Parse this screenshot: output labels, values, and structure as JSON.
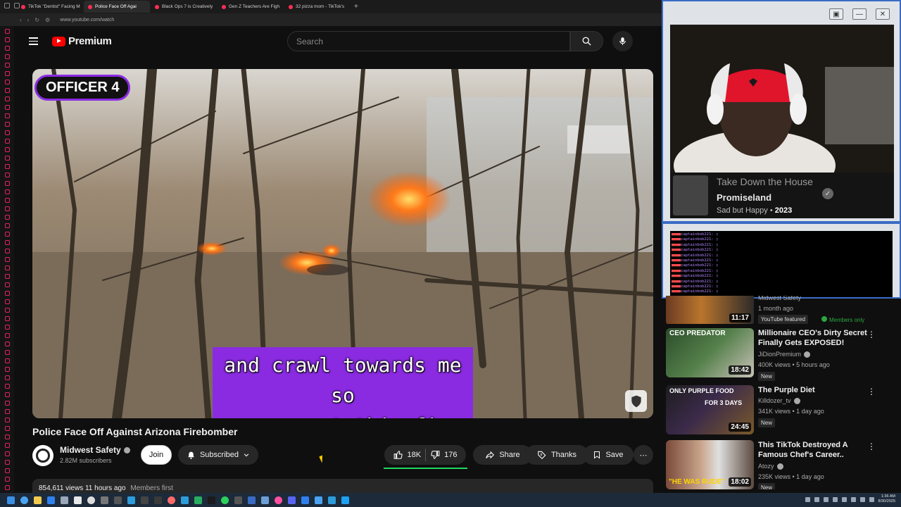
{
  "browser": {
    "tabs": [
      {
        "title": "TikTok \"Dentist\" Facing M",
        "active": false
      },
      {
        "title": "Police Face Off Agai",
        "active": true
      },
      {
        "title": "Black Ops 7 is Creatively",
        "active": false
      },
      {
        "title": "Gen Z Teachers Are Figh",
        "active": false
      },
      {
        "title": "32 pizza mom - TikTok's",
        "active": false
      }
    ],
    "new_tab": "+",
    "url": "www.youtube.com/watch"
  },
  "header": {
    "logo_text": "Premium",
    "search_placeholder": "Search",
    "brand_color": "#ff0000"
  },
  "player": {
    "officer_label": "OFFICER 4",
    "caption_lines": [
      "and crawl towards me so",
      "we can put this fire out!"
    ],
    "accent": "#8a2be2"
  },
  "video": {
    "title": "Police Face Off Against Arizona Firebomber",
    "channel": "Midwest Safety",
    "subscribers": "2.82M subscribers",
    "join_label": "Join",
    "subscribed_label": "Subscribed",
    "likes": "18K",
    "dislikes": "176",
    "share_label": "Share",
    "thanks_label": "Thanks",
    "save_label": "Save",
    "more_label": "⋯",
    "views_line": "854,611 views  11 hours ago",
    "members_first": "Members first"
  },
  "stream_overlay": {
    "window_controls": [
      "▣",
      "—",
      "✕"
    ],
    "song_title": "Take Down the House",
    "album": "Promiseland",
    "artist": "Sad but Happy",
    "year": "2023",
    "chat_user": "captainbob221:"
  },
  "recommendations": [
    {
      "title": "",
      "channel": "Midwest Safety",
      "meta": "1 month ago",
      "badges": [
        "YouTube featured",
        "Members only"
      ],
      "duration": "11:17",
      "thumb_text": ""
    },
    {
      "title": "Millionaire CEO's Dirty Secret Finally Gets EXPOSED!",
      "channel": "JiDionPremium",
      "meta": "400K views • 5 hours ago",
      "badge": "New",
      "duration": "18:42",
      "thumb_text": "CEO PREDATOR"
    },
    {
      "title": "The Purple Diet",
      "channel": "Killdozer_tv",
      "meta": "341K views • 1 day ago",
      "badge": "New",
      "duration": "24:45",
      "thumb_text": "ONLY PURPLE FOOD",
      "thumb_text2": "FOR 3 DAYS"
    },
    {
      "title": "This TikTok Destroyed A Famous Chef's Career..",
      "channel": "Atozy",
      "meta": "235K views • 1 day ago",
      "badge": "New",
      "duration": "18:02",
      "thumb_text": "\"HE WAS RUDE\""
    }
  ],
  "taskbar": {
    "time": "1:36 AM",
    "date": "8/30/2025"
  }
}
